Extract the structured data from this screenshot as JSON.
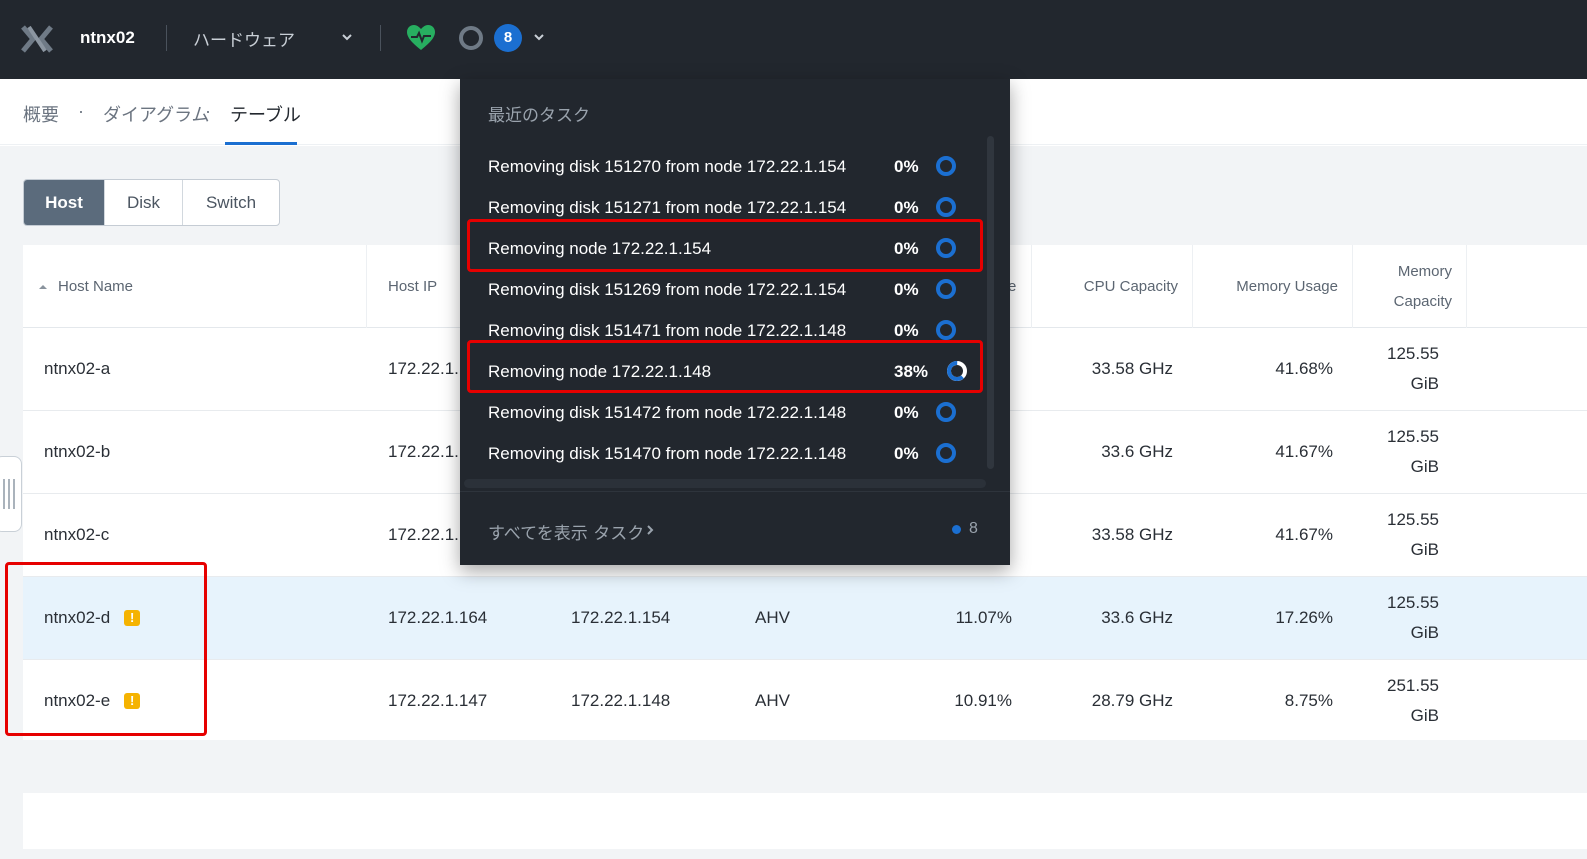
{
  "topbar": {
    "cluster_name": "ntnx02",
    "menu_label": "ハードウェア",
    "task_count": "8"
  },
  "subnav": {
    "tabs": [
      "概要",
      "ダイアグラム",
      "テーブル"
    ],
    "active_tab": "テーブル"
  },
  "segmented": {
    "options": [
      "Host",
      "Disk",
      "Switch"
    ],
    "active": "Host"
  },
  "table": {
    "columns": {
      "host_name": "Host Name",
      "host_ip": "Host IP",
      "col_e_fragment": "e",
      "cpu_capacity": "CPU Capacity",
      "memory_usage": "Memory Usage",
      "memory_capacity_line1": "Memory",
      "memory_capacity_line2": "Capacity"
    },
    "rows": [
      {
        "name": "ntnx02-a",
        "host_ip": "172.22.1.1",
        "cvm_ip": "",
        "hypervisor": "",
        "cpu_usage": "",
        "cpu_capacity": "33.58 GHz",
        "memory_usage": "41.68%",
        "mem_val": "125.55",
        "mem_unit": "GiB"
      },
      {
        "name": "ntnx02-b",
        "host_ip": "172.22.1.1",
        "cvm_ip": "",
        "hypervisor": "",
        "cpu_usage": "",
        "cpu_capacity": "33.6 GHz",
        "memory_usage": "41.67%",
        "mem_val": "125.55",
        "mem_unit": "GiB"
      },
      {
        "name": "ntnx02-c",
        "host_ip": "172.22.1.1",
        "cvm_ip": "",
        "hypervisor": "",
        "cpu_usage": "",
        "cpu_capacity": "33.58 GHz",
        "memory_usage": "41.67%",
        "mem_val": "125.55",
        "mem_unit": "GiB"
      },
      {
        "name": "ntnx02-d",
        "host_ip": "172.22.1.164",
        "cvm_ip": "172.22.1.154",
        "hypervisor": "AHV",
        "cpu_usage": "11.07%",
        "cpu_capacity": "33.6 GHz",
        "memory_usage": "17.26%",
        "mem_val": "125.55",
        "mem_unit": "GiB",
        "warning": "!"
      },
      {
        "name": "ntnx02-e",
        "host_ip": "172.22.1.147",
        "cvm_ip": "172.22.1.148",
        "hypervisor": "AHV",
        "cpu_usage": "10.91%",
        "cpu_capacity": "28.79 GHz",
        "memory_usage": "8.75%",
        "mem_val": "251.55",
        "mem_unit": "GiB",
        "warning": "!"
      }
    ]
  },
  "tasks_panel": {
    "title": "最近のタスク",
    "tasks": [
      {
        "label": "Removing disk 151270 from node 172.22.1.154",
        "percent": "0%",
        "progress": 0
      },
      {
        "label": "Removing disk 151271 from node 172.22.1.154",
        "percent": "0%",
        "progress": 0
      },
      {
        "label": "Removing node 172.22.1.154",
        "percent": "0%",
        "progress": 0
      },
      {
        "label": "Removing disk 151269 from node 172.22.1.154",
        "percent": "0%",
        "progress": 0
      },
      {
        "label": "Removing disk 151471 from node 172.22.1.148",
        "percent": "0%",
        "progress": 0
      },
      {
        "label": "Removing node 172.22.1.148",
        "percent": "38%",
        "progress": 0.38
      },
      {
        "label": "Removing disk 151472 from node 172.22.1.148",
        "percent": "0%",
        "progress": 0
      },
      {
        "label": "Removing disk 151470 from node 172.22.1.148",
        "percent": "0%",
        "progress": 0
      }
    ],
    "view_all": "すべてを表示 タスク",
    "footer_count": "8"
  },
  "colors": {
    "topbar_bg": "#22272e",
    "accent_blue": "#1b6fd1",
    "health_green": "#27ae60",
    "warning_yellow": "#f5b301",
    "highlight_red": "#e60000",
    "selected_row": "#e7f3fc"
  },
  "icons": {
    "logo": "nutanix-x-logo-icon",
    "health": "health-heart-icon",
    "alerts": "alert-circle-icon",
    "chevron": "chevron-down-icon",
    "sort": "sort-asc-icon",
    "warning": "warning-icon",
    "task_progress": "progress-ring-icon"
  }
}
